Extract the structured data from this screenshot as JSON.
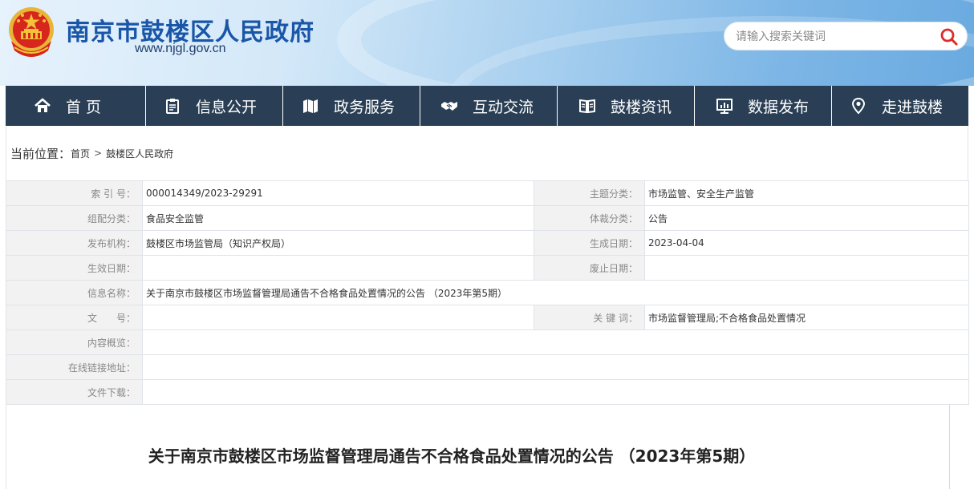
{
  "site": {
    "title": "南京市鼓楼区人民政府",
    "url": "www.njgl.gov.cn"
  },
  "search": {
    "placeholder": "请输入搜索关键词"
  },
  "nav": [
    {
      "label": "首 页",
      "icon": "home-icon"
    },
    {
      "label": "信息公开",
      "icon": "clipboard-icon"
    },
    {
      "label": "政务服务",
      "icon": "map-icon"
    },
    {
      "label": "互动交流",
      "icon": "handshake-icon"
    },
    {
      "label": "鼓楼资讯",
      "icon": "book-icon"
    },
    {
      "label": "数据发布",
      "icon": "monitor-chart-icon"
    },
    {
      "label": "走进鼓楼",
      "icon": "location-pin-icon"
    }
  ],
  "breadcrumb": {
    "label": "当前位置：",
    "items": [
      "首页",
      "鼓楼区人民政府"
    ],
    "separator": ">"
  },
  "info": {
    "index_label": "索 引 号：",
    "index_value": "000014349/2023-29291",
    "topic_label": "主题分类：",
    "topic_value": "市场监管、安全生产监管",
    "group_label": "组配分类：",
    "group_value": "食品安全监管",
    "genre_label": "体裁分类：",
    "genre_value": "公告",
    "publisher_label": "发布机构：",
    "publisher_value": "鼓楼区市场监管局（知识产权局）",
    "created_label": "生成日期：",
    "created_value": "2023-04-04",
    "effective_label": "生效日期：",
    "effective_value": "",
    "abolished_label": "废止日期：",
    "abolished_value": "",
    "name_label": "信息名称：",
    "name_value": "关于南京市鼓楼区市场监督管理局通告不合格食品处置情况的公告 （2023年第5期）",
    "docno_label": "文　　号：",
    "docno_value": "",
    "keywords_label": "关 键 词：",
    "keywords_value": "市场监督管理局;不合格食品处置情况",
    "summary_label": "内容概览：",
    "summary_value": "",
    "link_label": "在线链接地址：",
    "link_value": "",
    "download_label": "文件下载：",
    "download_value": ""
  },
  "article": {
    "title": "关于南京市鼓楼区市场监督管理局通告不合格食品处置情况的公告 （2023年第5期）"
  },
  "colors": {
    "nav_bg": "#2a3f55",
    "title_blue": "#1a56a8",
    "emblem_red": "#d7261c",
    "emblem_gold": "#f3c33a"
  }
}
